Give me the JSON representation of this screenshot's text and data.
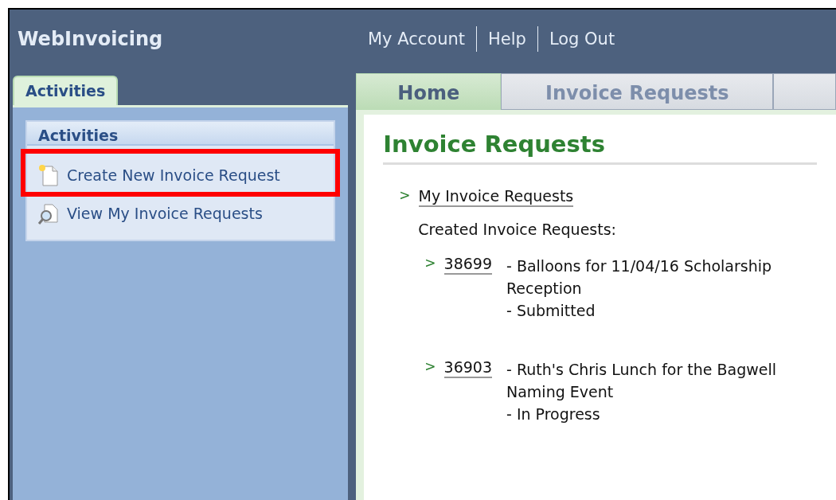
{
  "app_title": "WebInvoicing",
  "top_links": [
    "My Account",
    "Help",
    "Log Out"
  ],
  "sidebar": {
    "tab": {
      "label": "Activities",
      "selected": true
    },
    "panel_title": "Activities",
    "items": [
      {
        "label": "Create New Invoice Request",
        "kind": "new",
        "highlighted": true
      },
      {
        "label": "View My Invoice Requests",
        "kind": "view",
        "highlighted": false
      }
    ]
  },
  "tabs": [
    {
      "label": "Home",
      "selected": true
    },
    {
      "label": "Invoice Requests",
      "selected": false
    }
  ],
  "content": {
    "heading": "Invoice Requests",
    "bullet": ">",
    "link": "My Invoice Requests",
    "list_title": "Created Invoice Requests:",
    "requests": [
      {
        "bullet": ">",
        "number": "38699",
        "description": "- Balloons for 11/04/16 Scholarship Reception",
        "status": "- Submitted"
      },
      {
        "bullet": ">",
        "number": "36903",
        "description": "- Ruth's Chris Lunch for the Bagwell Naming Event",
        "status": "- In Progress"
      }
    ]
  }
}
